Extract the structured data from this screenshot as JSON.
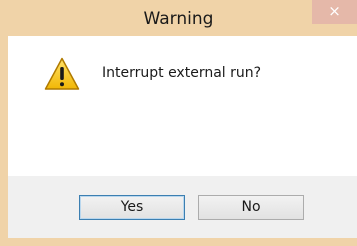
{
  "dialog": {
    "title": "Warning",
    "close_glyph": "×",
    "message": "Interrupt external run?",
    "icon": "warning-icon",
    "buttons": {
      "yes_label": "Yes",
      "no_label": "No"
    }
  },
  "colors": {
    "frame": "#f0d3a8",
    "close_button": "#e5b8a9",
    "content_bg": "#ffffff",
    "footer_bg": "#f0f0f0",
    "default_button_border": "#3c7fb1",
    "warning_fill": "#f6c51a"
  }
}
